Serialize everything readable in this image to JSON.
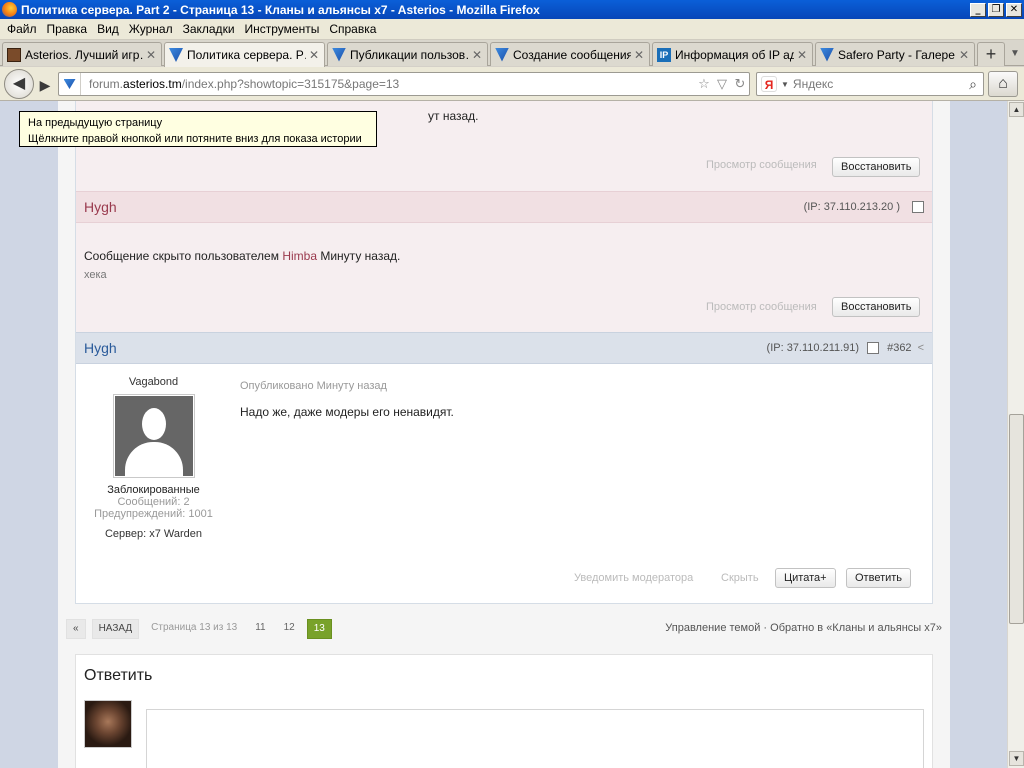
{
  "window": {
    "title": "Политика сервера. Part 2 - Страница 13 - Кланы и альянсы x7 - Asterios - Mozilla Firefox",
    "controls": [
      "_",
      "❐",
      "✕"
    ]
  },
  "menu": [
    "Файл",
    "Правка",
    "Вид",
    "Журнал",
    "Закладки",
    "Инструменты",
    "Справка"
  ],
  "tabs": [
    {
      "label": "Asterios. Лучший игр…",
      "icon": "asterios-icon",
      "active": false
    },
    {
      "label": "Политика сервера. Р…",
      "icon": "forum-icon",
      "active": true
    },
    {
      "label": "Публикации пользов…",
      "icon": "forum-icon",
      "active": false
    },
    {
      "label": "Создание сообщения…",
      "icon": "forum-icon",
      "active": false
    },
    {
      "label": "Информация об IP ад…",
      "icon": "ip-icon",
      "active": false
    },
    {
      "label": "Safero Party - Галере…",
      "icon": "forum-icon",
      "active": false
    }
  ],
  "tab_close": "✕",
  "new_tab": "+",
  "nav": {
    "url_host_prefix": "forum.",
    "url_host": "asterios.tm",
    "url_path": "/index.php?showtopic=315175&page=13",
    "search_engine": "Я",
    "search_placeholder": "Яндекс"
  },
  "tooltip": {
    "line1": "На предыдущую страницу",
    "line2": "Щёлкните правой кнопкой или потяните вниз для показа истории"
  },
  "post1": {
    "partial_text": "ут назад.",
    "view_link": "Просмотр сообщения",
    "restore": "Восстановить"
  },
  "post2": {
    "author": "Hygh",
    "ip": "(IP: 37.110.213.20 )",
    "hidden_prefix": "Сообщение скрыто пользователем",
    "hidden_by": "Himba",
    "hidden_when": "Минуту назад.",
    "reason": "хека",
    "view_link": "Просмотр сообщения",
    "restore": "Восстановить"
  },
  "post3": {
    "author": "Hygh",
    "ip": "(IP: 37.110.211.91)",
    "number": "#362",
    "rank": "Vagabond",
    "group": "Заблокированные",
    "posts": "Сообщений: 2",
    "warnings": "Предупреждений: 1001",
    "server": "Сервер: x7 Warden",
    "published": "Опубликовано Минуту назад",
    "body": "Надо же, даже модеры его ненавидят.",
    "report": "Уведомить модератора",
    "hide": "Скрыть",
    "quote": "Цитата+",
    "reply": "Ответить"
  },
  "pagination": {
    "prev_arrow": "«",
    "back": "НАЗАД",
    "page_info": "Страница 13 из 13",
    "pages": [
      "11",
      "12",
      "13"
    ],
    "current": "13",
    "manage": "Управление темой",
    "separator": "·",
    "back_to": "Обратно в «Кланы и альянсы x7»"
  },
  "reply_box": {
    "title": "Ответить"
  },
  "colors": {
    "hidden_post_bg": "#f6eef0",
    "hidden_author": "#9a3a4e",
    "visible_author": "#2a5a9a",
    "current_page": "#79a22a"
  }
}
